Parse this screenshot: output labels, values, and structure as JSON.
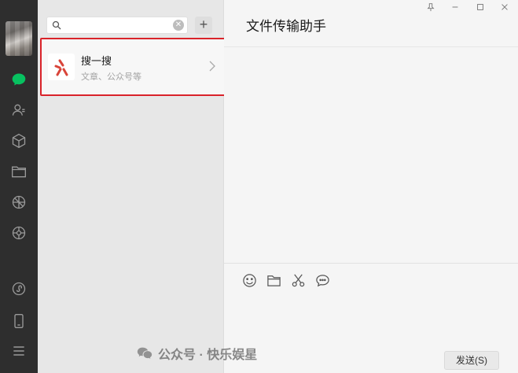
{
  "sidebar": {
    "icons": [
      "chat-icon",
      "contacts-icon",
      "favorites-icon",
      "files-icon",
      "moments-icon",
      "channels-icon",
      "mini-program-icon",
      "phone-icon",
      "menu-icon"
    ],
    "active_color": "#07c160"
  },
  "search": {
    "value": "",
    "placeholder": "",
    "add_label": "+"
  },
  "result": {
    "title": "搜一搜",
    "subtitle": "文章、公众号等",
    "highlight_color": "#d9232a"
  },
  "chat": {
    "title": "文件传输助手",
    "window_controls": [
      "pin-icon",
      "minimize-icon",
      "maximize-icon",
      "close-icon"
    ],
    "toolbar": [
      "emoji-icon",
      "folder-icon",
      "scissors-icon",
      "chat-bubble-icon"
    ],
    "send_label": "发送(S)"
  },
  "watermark": {
    "text": "公众号 · 快乐娱星"
  }
}
